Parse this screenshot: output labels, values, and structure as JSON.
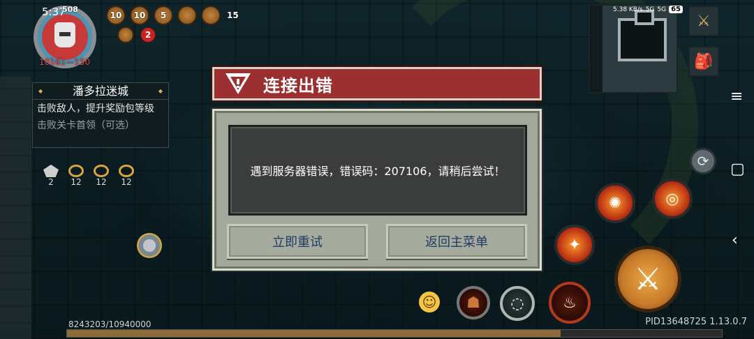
{
  "status_bar": {
    "time": "5:37",
    "net_speed": "5.38 KB/s",
    "sig1": "5G",
    "sig2": "5G",
    "battery": "65"
  },
  "player": {
    "level_badge": "508",
    "hp": "10161",
    "hp_sep": "—",
    "armor": "150"
  },
  "buffs": [
    "10",
    "10",
    "5",
    "",
    "",
    "15"
  ],
  "extra_badge": "2",
  "quest": {
    "title": "潘多拉迷城",
    "objective1": "击败敌人，提升奖励包等级",
    "objective2": "击败关卡首领（可选）"
  },
  "loot": [
    {
      "icon": "gem-icon",
      "count": "2"
    },
    {
      "icon": "ring-icon",
      "count": "12"
    },
    {
      "icon": "ring-icon",
      "count": "12"
    },
    {
      "icon": "ring-icon",
      "count": "12"
    }
  ],
  "xp": {
    "text": "8243203/10940000",
    "fraction": 0.7535
  },
  "version": "PID13648725 1.13.0.7",
  "dialog": {
    "title": "连接出错",
    "message": "遇到服务器错误，错误码：207106，请稍后尝试！",
    "retry_label": "立即重试",
    "menu_label": "返回主菜单"
  },
  "colors": {
    "title_bg": "#9c2f2f",
    "dialog_bg": "#a3a89a",
    "button_text": "#1f3c63"
  }
}
